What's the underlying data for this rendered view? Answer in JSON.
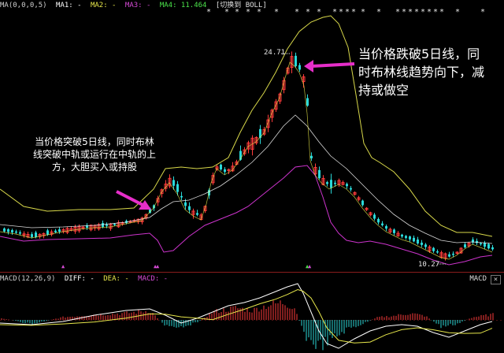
{
  "header": {
    "ma": "MA(0,0,0,5)",
    "ma1": "MA1: -",
    "ma2": "MA2: -",
    "ma3": "MA3: -",
    "ma4": "MA4: 11.464",
    "switch": "[切换到 BOLL]"
  },
  "annotations": {
    "left_text": "当价格突破5日线，同时布林线突破中轨或运行在中轨的上方，大胆买入或持股",
    "right_text": "当价格跌破5日线，同时布林线趋势向下，减持或做空"
  },
  "price_labels": {
    "high": "24.71",
    "low": "10.27"
  },
  "macd_header": {
    "title": "MACD(12,26,9)",
    "diff": "DIFF: -",
    "dea": "DEA: -",
    "macd": "MACD: -",
    "right_label": "MACD",
    "close_symbol": "×"
  },
  "colors": {
    "up": "#ff3b3b",
    "down": "#2bd9d9",
    "upper_band": "#d8d84a",
    "mid_band": "#ffffff",
    "lower_band": "#cc33cc",
    "ma5": "#ffffff",
    "arrow": "#e62ec9"
  }
}
